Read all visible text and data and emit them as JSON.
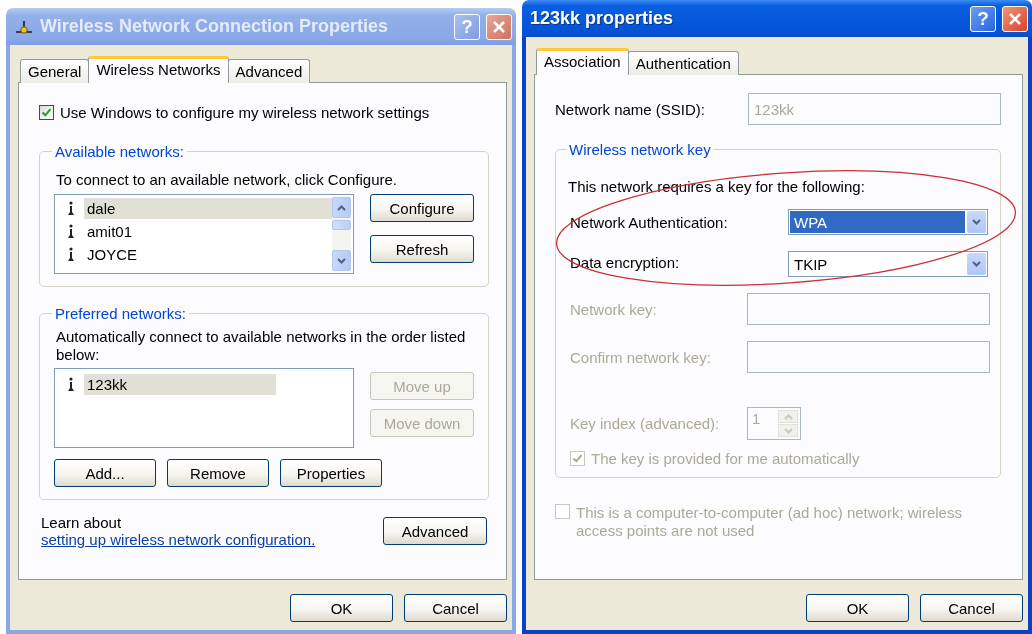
{
  "connection_properties": {
    "title": "Wireless Network Connection Properties",
    "active": false,
    "help_button": "?",
    "tabs": [
      {
        "label": "General",
        "selected": false
      },
      {
        "label": "Wireless Networks",
        "selected": true
      },
      {
        "label": "Advanced",
        "selected": false
      }
    ],
    "use_windows": {
      "label": "Use Windows to configure my wireless network settings",
      "checked": true
    },
    "available_networks": {
      "title": "Available networks:",
      "instruction": "To connect to an available network, click Configure.",
      "networks": [
        {
          "name": "dale",
          "selected": true
        },
        {
          "name": "amit01",
          "selected": false
        },
        {
          "name": "JOYCE",
          "selected": false
        }
      ],
      "buttons": [
        {
          "label": "Configure",
          "disabled": false
        },
        {
          "label": "Refresh",
          "disabled": false
        }
      ]
    },
    "preferred_networks": {
      "title": "Preferred networks:",
      "instruction": "Automatically connect to available networks in the order listed below:",
      "networks": [
        {
          "name": "123kk",
          "selected": true
        }
      ],
      "order_buttons": [
        {
          "label": "Move up",
          "disabled": true
        },
        {
          "label": "Move down",
          "disabled": true
        }
      ],
      "buttons": [
        {
          "label": "Add...",
          "disabled": false
        },
        {
          "label": "Remove",
          "disabled": false
        },
        {
          "label": "Properties",
          "disabled": false
        }
      ]
    },
    "learn_text": "Learn about ",
    "learn_link": "setting up wireless network configuration.",
    "advanced_button": "Advanced",
    "dialog_buttons": [
      "OK",
      "Cancel"
    ]
  },
  "network_properties": {
    "title": "123kk properties",
    "active": true,
    "help_button": "?",
    "tabs": [
      {
        "label": "Association",
        "selected": true
      },
      {
        "label": "Authentication",
        "selected": false
      }
    ],
    "ssid": {
      "label": "Network name (SSID):",
      "value": "123kk",
      "disabled": true
    },
    "key_group": {
      "title": "Wireless network key",
      "intro": "This network requires a key for the following:",
      "authentication": {
        "label": "Network Authentication:",
        "value": "WPA",
        "highlighted": true
      },
      "encryption": {
        "label": "Data encryption:",
        "value": "TKIP",
        "highlighted": false
      },
      "network_key": {
        "label": "Network key:",
        "disabled": true
      },
      "confirm_key": {
        "label": "Confirm network key:",
        "disabled": true
      },
      "key_index": {
        "label": "Key index (advanced):",
        "value": "1",
        "disabled": true
      },
      "auto_key": {
        "label": "The key is provided for me automatically",
        "checked": true,
        "disabled": true
      }
    },
    "adhoc": {
      "label": "This is a computer-to-computer (ad hoc) network; wireless access points are not used",
      "checked": false,
      "disabled": true
    },
    "dialog_buttons": [
      "OK",
      "Cancel"
    ]
  }
}
